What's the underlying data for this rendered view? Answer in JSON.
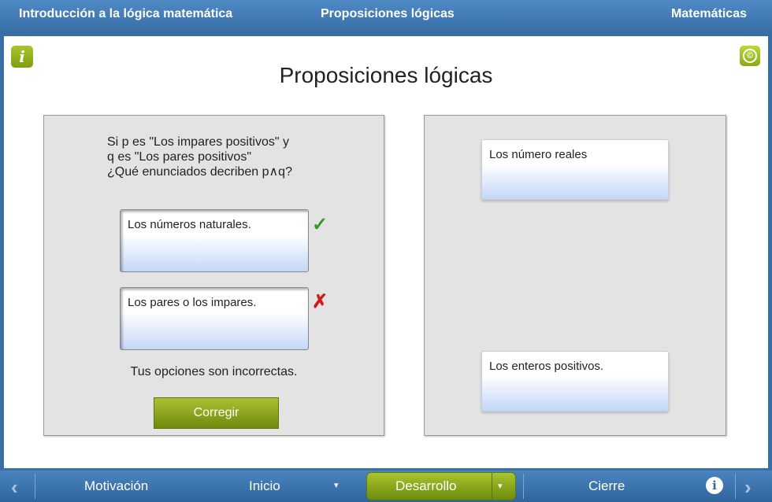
{
  "header": {
    "left": "Introducción a la lógica matemática",
    "center": "Proposiciones lógicas",
    "right": "Matemáticas"
  },
  "stage": {
    "info_badge": "i",
    "copyright_badge": "©",
    "title": "Proposiciones lógicas"
  },
  "question": {
    "line1": "Si p es \"Los impares positivos\" y",
    "line2": "q es \"Los pares positivos\"",
    "line3": "¿Qué enunciados decriben p∧q?"
  },
  "answers": [
    {
      "text": "Los números naturales.",
      "mark": "✓"
    },
    {
      "text": "Los pares o los impares.",
      "mark": "✗"
    }
  ],
  "feedback": "Tus opciones son incorrectas.",
  "corregir_label": "Corregir",
  "options": [
    {
      "text": "Los número reales"
    },
    {
      "text": "Los enteros positivos."
    }
  ],
  "nav": {
    "prev": "‹",
    "motivacion": "Motivación",
    "inicio": "Inicio",
    "inicio_caret": "▾",
    "desarrollo": "Desarrollo",
    "desarrollo_caret": "▾",
    "cierre": "Cierre",
    "info": "i",
    "next": "›"
  },
  "colors": {
    "header_blue": "#3a70aa",
    "accent_green": "#8bab19",
    "check_green": "#2e9c1c",
    "error_red": "#d21a1a"
  }
}
